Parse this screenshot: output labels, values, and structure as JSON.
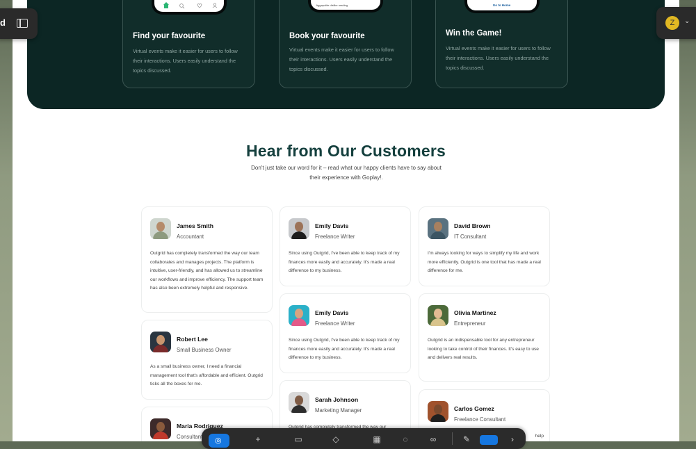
{
  "features": [
    {
      "title": "Find your favourite",
      "text": "Virtual events make it easier for users to follow their interactions. Users easily understand the topics discussed."
    },
    {
      "title": "Book your favourite",
      "text": "Virtual events make it easier for users to follow their interactions. Users easily understand the topics discussed."
    },
    {
      "title": "Win the Game!",
      "text": "Virtual events make it easier for users to follow their interactions. Users easily understand the topics discussed."
    }
  ],
  "phones": {
    "mid_text": "Aggapolite dislike reading",
    "right_text": "Go to Home"
  },
  "section": {
    "title": "Hear from Our Customers",
    "subtitle": "Don't just take our word for it – read what our happy clients have to say about their experience with Goplay!."
  },
  "testimonials": [
    {
      "name": "James Smith",
      "role": "Accountant",
      "text": "Outgrid has completely transformed the way our team collaborates and manages projects. The platform is intuitive, user-friendly, and has allowed us to streamline our workflows and improve efficiency. The support team has also been extremely helpful and responsive."
    },
    {
      "name": "Robert Lee",
      "role": "Small Business Owner",
      "text": "As a small business owner, I need a financial management tool that's affordable and efficient. Outgrid ticks all the boxes for me."
    },
    {
      "name": "Maria Rodriguez",
      "role": "Consultant",
      "text": ""
    },
    {
      "name": "Emily Davis",
      "role": "Freelance Writer",
      "text": "Since using Outgrid, I've been able to keep track of my finances more easily and accurately. It's made a real difference to my business."
    },
    {
      "name": "Emily Davis",
      "role": "Freelance Writer",
      "text": "Since using Outgrid, I've been able to keep track of my finances more easily and accurately. It's made a real difference to my business."
    },
    {
      "name": "Sarah Johnson",
      "role": "Marketing Manager",
      "text": "Outgrid has completely transformed the way our"
    },
    {
      "name": "David Brown",
      "role": "IT Consultant",
      "text": "I'm always looking for ways to simplify my life and work more efficiently. Outgrid is one tool that has made a real difference for me."
    },
    {
      "name": "Olivia Martinez",
      "role": "Entrepreneur",
      "text": "Outgrid is an indispensable tool for any entrepreneur looking to take control of their finances. It's easy to use and delivers real results."
    },
    {
      "name": "Carlos Gomez",
      "role": "Freelance Consultant",
      "text": "help"
    }
  ],
  "browser": {
    "left_label": "d",
    "avatar_initial": "Z"
  },
  "colors": {
    "dark_bg": "#0c2624",
    "title_color": "#143f3d",
    "accent": "#1677e0",
    "avatar_bg": "#e1b823"
  },
  "icons": [
    "sidebar-toggle-icon",
    "chevron-down-icon",
    "globe-icon",
    "plus-icon",
    "book-icon",
    "layers-icon",
    "grid-icon",
    "gear-icon",
    "note-icon",
    "home-icon",
    "search-icon",
    "heart-icon",
    "user-icon"
  ]
}
